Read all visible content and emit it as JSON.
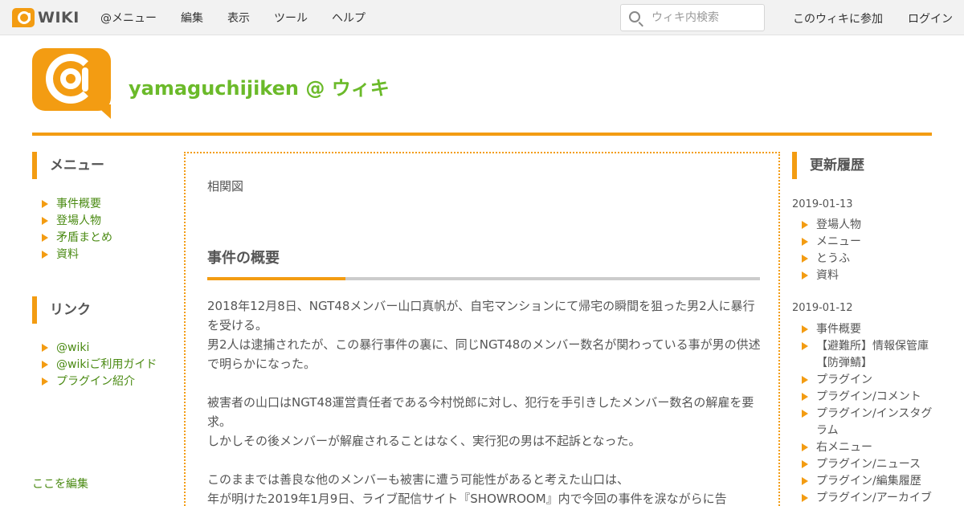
{
  "topbar": {
    "logo_text": "WIKI",
    "nav": [
      "@メニュー",
      "編集",
      "表示",
      "ツール",
      "ヘルプ"
    ],
    "search_placeholder": "ウィキ内検索",
    "join": "このウィキに参加",
    "login": "ログイン"
  },
  "header": {
    "site_title": "yamaguchijiken @ ウィキ"
  },
  "left": {
    "menu_title": "メニュー",
    "menu_items": [
      "事件概要",
      "登場人物",
      "矛盾まとめ",
      "資料"
    ],
    "links_title": "リンク",
    "link_items": [
      "@wiki",
      "@wikiご利用ガイド",
      "プラグイン紹介"
    ],
    "edit_link": "ここを編集"
  },
  "main": {
    "top_text": "相関図",
    "heading": "事件の概要",
    "paragraphs": [
      "2018年12月8日、NGT48メンバー山口真帆が、自宅マンションにて帰宅の瞬間を狙った男2人に暴行を受ける。",
      "男2人は逮捕されたが、この暴行事件の裏に、同じNGT48のメンバー数名が関わっている事が男の供述で明らかになった。",
      "被害者の山口はNGT48運営責任者である今村悦郎に対し、犯行を手引きしたメンバー数名の解雇を要求。",
      "しかしその後メンバーが解雇されることはなく、実行犯の男は不起訴となった。",
      "このままでは善良な他のメンバーも被害に遭う可能性があると考えた山口は、",
      "年が明けた2019年1月9日、ライブ配信サイト『SHOWROOM』内で今回の事件を涙ながらに告"
    ]
  },
  "right": {
    "title": "更新履歴",
    "groups": [
      {
        "date": "2019-01-13",
        "items": [
          "登場人物",
          "メニュー",
          "とうふ",
          "資料"
        ]
      },
      {
        "date": "2019-01-12",
        "items": [
          "事件概要",
          "【避難所】情報保管庫【防弾鯖】",
          "プラグイン",
          "プラグイン/コメント",
          "プラグイン/インスタグラム",
          "右メニュー",
          "プラグイン/ニュース",
          "プラグイン/編集履歴",
          "プラグイン/アーカイブ"
        ]
      }
    ]
  },
  "colors": {
    "accent": "#f39c12",
    "title_green": "#6bba2a",
    "link_green": "#4a8a12"
  }
}
